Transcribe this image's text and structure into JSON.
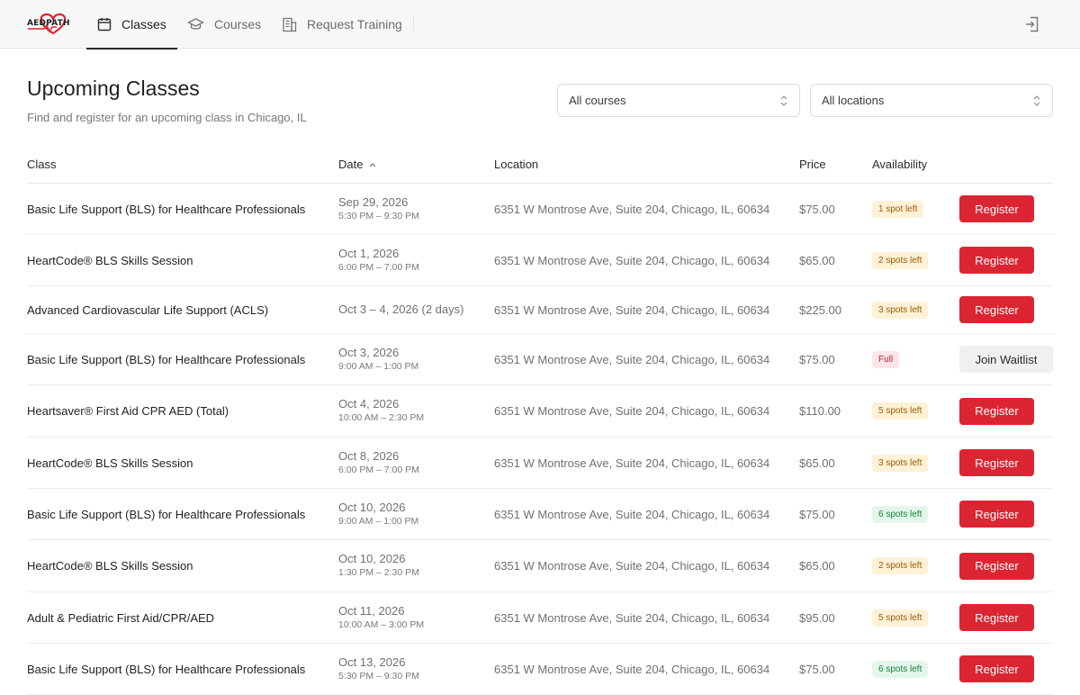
{
  "nav": {
    "logo_text": "AEDPATH",
    "items": [
      {
        "label": "Classes",
        "icon": "calendar-icon",
        "active": true
      },
      {
        "label": "Courses",
        "icon": "graduation-cap-icon",
        "active": false
      },
      {
        "label": "Request Training",
        "icon": "building-icon",
        "active": false
      }
    ],
    "logout_icon": "sign-in-icon"
  },
  "header": {
    "title": "Upcoming Classes",
    "subtitle": "Find and register for an upcoming class in Chicago, IL"
  },
  "filters": {
    "course_select": "All courses",
    "location_select": "All locations"
  },
  "table": {
    "columns": {
      "class": "Class",
      "date": "Date",
      "location": "Location",
      "price": "Price",
      "availability": "Availability"
    },
    "date_sort": "ascending",
    "rows": [
      {
        "name": "Basic Life Support (BLS) for Healthcare Professionals",
        "date": "Sep 29, 2026",
        "time": "5:30 PM – 9:30 PM",
        "location": "6351 W Montrose Ave, Suite 204, Chicago, IL, 60634",
        "price": "$75.00",
        "availability": "1 spot left",
        "status": "warn",
        "action": "Register"
      },
      {
        "name": "HeartCode® BLS Skills Session",
        "date": "Oct 1, 2026",
        "time": "6:00 PM – 7:00 PM",
        "location": "6351 W Montrose Ave, Suite 204, Chicago, IL, 60634",
        "price": "$65.00",
        "availability": "2 spots left",
        "status": "warn",
        "action": "Register"
      },
      {
        "name": "Advanced Cardiovascular Life Support (ACLS)",
        "date": "Oct 3 – 4, 2026 (2 days)",
        "time": "",
        "location": "6351 W Montrose Ave, Suite 204, Chicago, IL, 60634",
        "price": "$225.00",
        "availability": "3 spots left",
        "status": "warn",
        "action": "Register"
      },
      {
        "name": "Basic Life Support (BLS) for Healthcare Professionals",
        "date": "Oct 3, 2026",
        "time": "9:00 AM – 1:00 PM",
        "location": "6351 W Montrose Ave, Suite 204, Chicago, IL, 60634",
        "price": "$75.00",
        "availability": "Full",
        "status": "full",
        "action": "Join Waitlist"
      },
      {
        "name": "Heartsaver® First Aid CPR AED (Total)",
        "date": "Oct 4, 2026",
        "time": "10:00 AM – 2:30 PM",
        "location": "6351 W Montrose Ave, Suite 204, Chicago, IL, 60634",
        "price": "$110.00",
        "availability": "5 spots left",
        "status": "warn",
        "action": "Register"
      },
      {
        "name": "HeartCode® BLS Skills Session",
        "date": "Oct 8, 2026",
        "time": "6:00 PM – 7:00 PM",
        "location": "6351 W Montrose Ave, Suite 204, Chicago, IL, 60634",
        "price": "$65.00",
        "availability": "3 spots left",
        "status": "warn",
        "action": "Register"
      },
      {
        "name": "Basic Life Support (BLS) for Healthcare Professionals",
        "date": "Oct 10, 2026",
        "time": "9:00 AM – 1:00 PM",
        "location": "6351 W Montrose Ave, Suite 204, Chicago, IL, 60634",
        "price": "$75.00",
        "availability": "6 spots left",
        "status": "ok",
        "action": "Register"
      },
      {
        "name": "HeartCode® BLS Skills Session",
        "date": "Oct 10, 2026",
        "time": "1:30 PM – 2:30 PM",
        "location": "6351 W Montrose Ave, Suite 204, Chicago, IL, 60634",
        "price": "$65.00",
        "availability": "2 spots left",
        "status": "warn",
        "action": "Register"
      },
      {
        "name": "Adult & Pediatric First Aid/CPR/AED",
        "date": "Oct 11, 2026",
        "time": "10:00 AM – 3:00 PM",
        "location": "6351 W Montrose Ave, Suite 204, Chicago, IL, 60634",
        "price": "$95.00",
        "availability": "5 spots left",
        "status": "warn",
        "action": "Register"
      },
      {
        "name": "Basic Life Support (BLS) for Healthcare Professionals",
        "date": "Oct 13, 2026",
        "time": "5:30 PM – 9:30 PM",
        "location": "6351 W Montrose Ave, Suite 204, Chicago, IL, 60634",
        "price": "$75.00",
        "availability": "6 spots left",
        "status": "ok",
        "action": "Register"
      }
    ]
  },
  "colors": {
    "brand_red": "#dc2532",
    "badge_warn_bg": "#fdf1d6",
    "badge_ok_bg": "#e3f6ea",
    "badge_full_bg": "#fde6e8"
  }
}
